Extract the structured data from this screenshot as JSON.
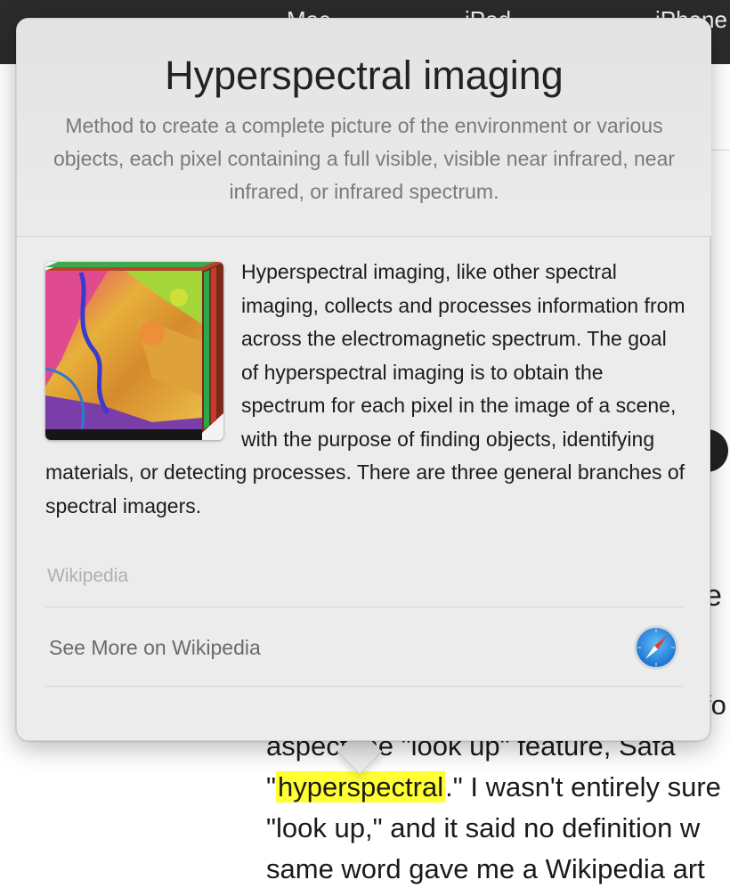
{
  "menubar": {
    "apple_glyph": "",
    "items": [
      "Mac",
      "iPad",
      "iPhone"
    ]
  },
  "popover": {
    "title": "Hyperspectral imaging",
    "subtitle": "Method to create a complete picture of the environment or various objects, each pixel containing a full visible, visible near infrared, near infrared, or infrared spectrum.",
    "body": "Hyperspectral imaging, like other spectral imaging, collects and processes information from across the electromagnetic spectrum. The goal of hyperspectral imaging is to obtain the spectrum for each pixel in the image of a scene, with the purpose of finding objects, identifying materials, or detecting processes. There are three general branches of spectral imagers.",
    "source": "Wikipedia",
    "see_more_label": "See More on Wikipedia",
    "safari_icon": "safari-compass-icon",
    "thumbnail_icon": "hyperspectral-cube-image"
  },
  "article": {
    "line1_pre": "aspect",
    "line1_post": " the \"look up\" feature, Safa",
    "line2_open_quote": "\"",
    "line2_highlight": "hyperspectral",
    "line2_post": ".\" I wasn't entirely sure",
    "line3": "\"look up,\" and it said no definition w",
    "line4": "same word gave me a Wikipedia art",
    "right_fragment_1": "e",
    "right_fragment_2": "fo"
  },
  "colors": {
    "highlight": "#ffff33",
    "popover_bg": "#ececec",
    "menubar_bg": "#2b2b2b"
  }
}
